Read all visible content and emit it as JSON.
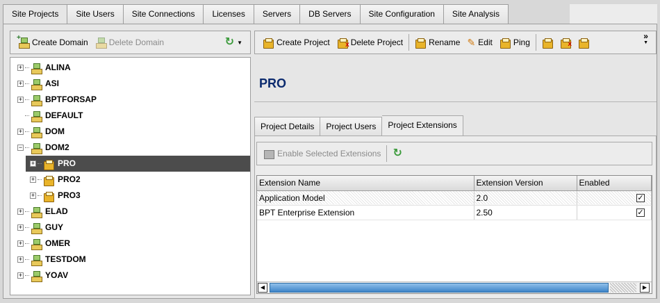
{
  "tabs": [
    "Site Projects",
    "Site Users",
    "Site Connections",
    "Licenses",
    "Servers",
    "DB Servers",
    "Site Configuration",
    "Site Analysis"
  ],
  "active_tab_index": 0,
  "left_toolbar": {
    "create_domain": "Create Domain",
    "delete_domain": "Delete Domain"
  },
  "right_toolbar": {
    "create_project": "Create Project",
    "delete_project": "Delete Project",
    "rename": "Rename",
    "edit": "Edit",
    "ping": "Ping",
    "overflow": "»"
  },
  "tree": {
    "items": [
      {
        "label": "ALINA",
        "type": "domain",
        "level": 0,
        "expander": "+"
      },
      {
        "label": "ASI",
        "type": "domain",
        "level": 0,
        "expander": "+"
      },
      {
        "label": "BPTFORSAP",
        "type": "domain",
        "level": 0,
        "expander": "+"
      },
      {
        "label": "DEFAULT",
        "type": "domain",
        "level": 0,
        "expander": ""
      },
      {
        "label": "DOM",
        "type": "domain",
        "level": 0,
        "expander": "+"
      },
      {
        "label": "DOM2",
        "type": "domain",
        "level": 0,
        "expander": "−"
      },
      {
        "label": "PRO",
        "type": "project",
        "level": 1,
        "expander": "+",
        "selected": true
      },
      {
        "label": "PRO2",
        "type": "project",
        "level": 1,
        "expander": "+"
      },
      {
        "label": "PRO3",
        "type": "project",
        "level": 1,
        "expander": "+"
      },
      {
        "label": "ELAD",
        "type": "domain",
        "level": 0,
        "expander": "+"
      },
      {
        "label": "GUY",
        "type": "domain",
        "level": 0,
        "expander": "+"
      },
      {
        "label": "OMER",
        "type": "domain",
        "level": 0,
        "expander": "+"
      },
      {
        "label": "TESTDOM",
        "type": "domain",
        "level": 0,
        "expander": "+"
      },
      {
        "label": "YOAV",
        "type": "domain",
        "level": 0,
        "expander": "+"
      }
    ]
  },
  "main": {
    "title": "PRO",
    "subtabs": [
      "Project Details",
      "Project Users",
      "Project Extensions"
    ],
    "active_subtab_index": 2,
    "extensions_toolbar": {
      "enable_selected": "Enable Selected Extensions"
    },
    "grid": {
      "columns": [
        "Extension Name",
        "Extension Version",
        "Enabled"
      ],
      "rows": [
        {
          "name": "Application Model",
          "version": "2.0",
          "enabled": true
        },
        {
          "name": "BPT Enterprise Extension",
          "version": "2.50",
          "enabled": true
        }
      ]
    }
  },
  "colors": {
    "title_text": "#0b2a6e",
    "selected_row": "#4c4c4c",
    "scrollbar_thumb": "#3d84c8"
  }
}
